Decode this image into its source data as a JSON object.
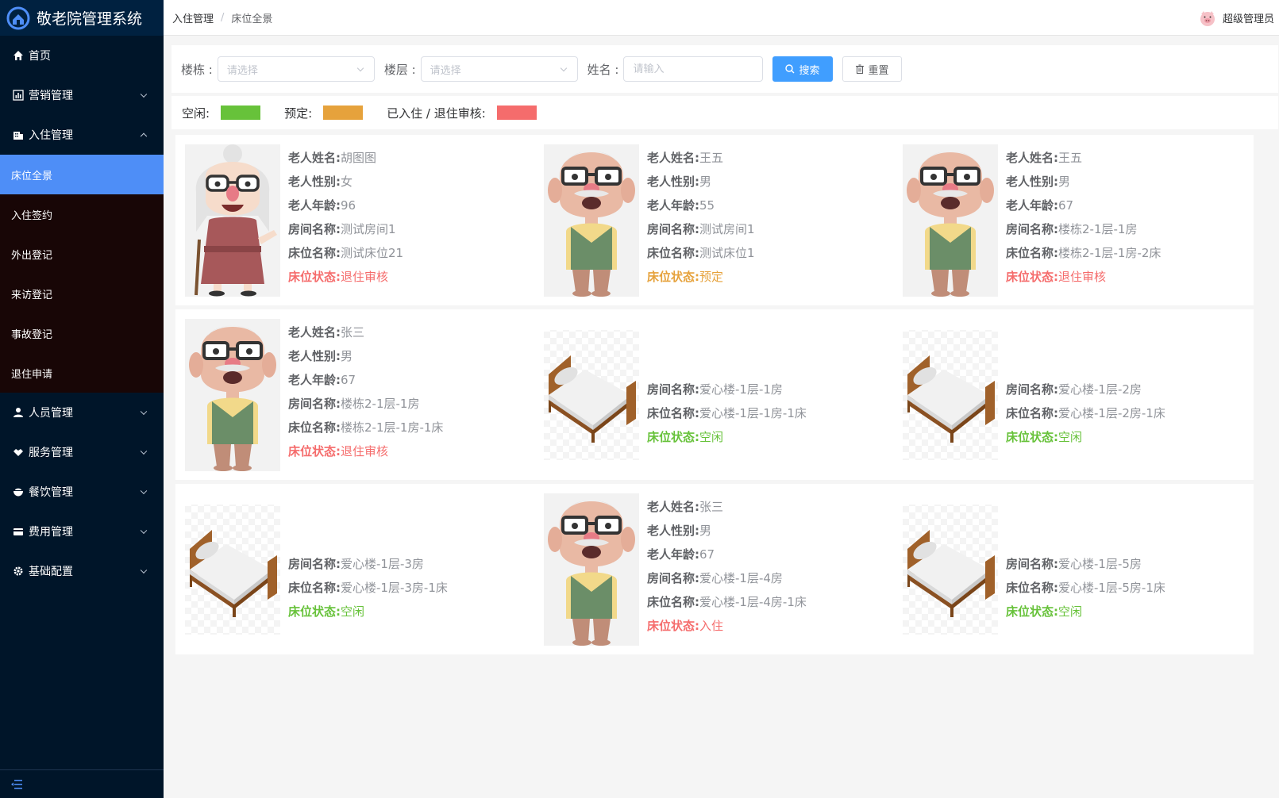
{
  "app": {
    "title": "敬老院管理系统"
  },
  "sidebar": {
    "items": [
      {
        "label": "首页",
        "icon": "home-icon"
      },
      {
        "label": "营销管理",
        "icon": "chart-icon"
      },
      {
        "label": "入住管理",
        "icon": "building-icon",
        "expanded": true,
        "children": [
          {
            "label": "床位全景",
            "active": true
          },
          {
            "label": "入住签约"
          },
          {
            "label": "外出登记"
          },
          {
            "label": "来访登记"
          },
          {
            "label": "事故登记"
          },
          {
            "label": "退住申请"
          }
        ]
      },
      {
        "label": "人员管理",
        "icon": "person-icon"
      },
      {
        "label": "服务管理",
        "icon": "handshake-icon"
      },
      {
        "label": "餐饮管理",
        "icon": "bowl-icon"
      },
      {
        "label": "费用管理",
        "icon": "card-icon"
      },
      {
        "label": "基础配置",
        "icon": "gear-icon"
      }
    ]
  },
  "header": {
    "breadcrumb": [
      "入住管理",
      "床位全景"
    ],
    "user": "超级管理员"
  },
  "search": {
    "building_label": "楼栋 :",
    "building_placeholder": "请选择",
    "floor_label": "楼层 :",
    "floor_placeholder": "请选择",
    "name_label": "姓名 :",
    "name_placeholder": "请输入",
    "search_button": "搜索",
    "reset_button": "重置"
  },
  "legend": [
    {
      "label": "空闲:",
      "color": "#67c23a"
    },
    {
      "label": "预定:",
      "color": "#e6a23c"
    },
    {
      "label": "已入住 / 退住审核:",
      "color": "#f56c6c"
    }
  ],
  "labels": {
    "name": "老人姓名:",
    "gender": "老人性别:",
    "age": "老人年龄:",
    "room": "房间名称:",
    "bed": "床位名称:",
    "status": "床位状态:"
  },
  "status_colors": {
    "退住审核": "#f56c6c",
    "入住": "#f56c6c",
    "预定": "#e6a23c",
    "空闲": "#67c23a"
  },
  "cards": [
    {
      "type": "elder",
      "avatar": "grandma",
      "name": "胡图图",
      "gender": "女",
      "age": "96",
      "room": "测试房间1",
      "bed": "测试床位21",
      "status": "退住审核"
    },
    {
      "type": "elder",
      "avatar": "grandpa",
      "name": "王五",
      "gender": "男",
      "age": "55",
      "room": "测试房间1",
      "bed": "测试床位1",
      "status": "预定"
    },
    {
      "type": "elder",
      "avatar": "grandpa",
      "name": "王五",
      "gender": "男",
      "age": "67",
      "room": "楼栋2-1层-1房",
      "bed": "楼栋2-1层-1房-2床",
      "status": "退住审核"
    },
    {
      "type": "elder",
      "avatar": "grandpa",
      "name": "张三",
      "gender": "男",
      "age": "67",
      "room": "楼栋2-1层-1房",
      "bed": "楼栋2-1层-1房-1床",
      "status": "退住审核"
    },
    {
      "type": "bed",
      "room": "爱心楼-1层-1房",
      "bed": "爱心楼-1层-1房-1床",
      "status": "空闲"
    },
    {
      "type": "bed",
      "room": "爱心楼-1层-2房",
      "bed": "爱心楼-1层-2房-1床",
      "status": "空闲"
    },
    {
      "type": "bed",
      "room": "爱心楼-1层-3房",
      "bed": "爱心楼-1层-3房-1床",
      "status": "空闲"
    },
    {
      "type": "elder",
      "avatar": "grandpa",
      "name": "张三",
      "gender": "男",
      "age": "67",
      "room": "爱心楼-1层-4房",
      "bed": "爱心楼-1层-4房-1床",
      "status": "入住"
    },
    {
      "type": "bed",
      "room": "爱心楼-1层-5房",
      "bed": "爱心楼-1层-5房-1床",
      "status": "空闲"
    }
  ]
}
